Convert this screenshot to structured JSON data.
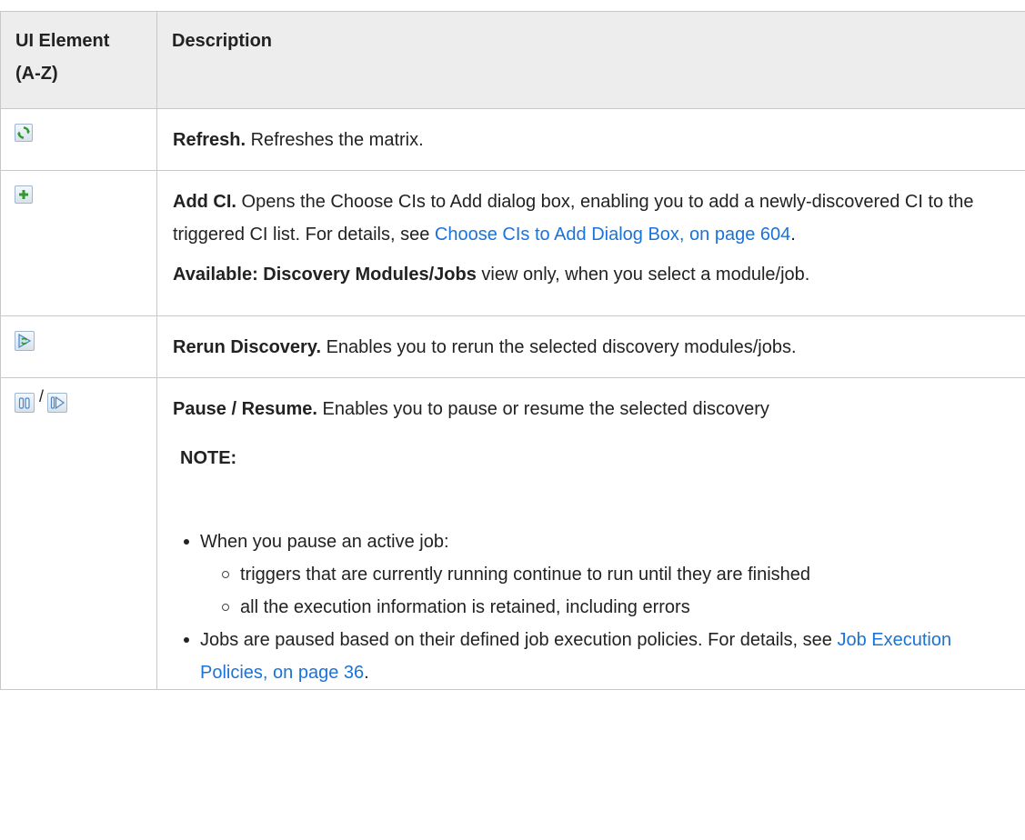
{
  "header": {
    "col1_line1": "UI Element",
    "col1_line2": "(A-Z)",
    "col2": "Description"
  },
  "colors": {
    "link": "#1a73d8",
    "header_bg": "#ededed",
    "border": "#c8c8c8"
  },
  "rows": {
    "refresh": {
      "icon": "refresh-icon",
      "title": "Refresh.",
      "text": " Refreshes the matrix."
    },
    "add_ci": {
      "icon": "add-icon",
      "title": "Add CI.",
      "text": " Opens the Choose CIs to Add dialog box, enabling you to add a newly-discovered CI to the triggered CI list. For details, see ",
      "link": "Choose CIs to Add Dialog Box, on page 604",
      "after_link": ".",
      "avail_title": "Available: Discovery Modules/Jobs",
      "avail_text": " view only, when you select a module/job."
    },
    "rerun": {
      "icon": "rerun-discovery-icon",
      "title": "Rerun Discovery.",
      "text": " Enables you to rerun the selected discovery modules/jobs."
    },
    "pause_resume": {
      "icon_pause": "pause-icon",
      "icon_resume": "resume-icon",
      "separator": "/",
      "title": "Pause / Resume.",
      "text": " Enables you to pause or resume the selected discovery",
      "note_label": "NOTE:",
      "bullet1": "When you pause an active job:",
      "sub1": "triggers that are currently running continue to run until they are finished",
      "sub2": "all the execution information is retained, including errors",
      "bullet2_text": "Jobs are paused based on their defined job execution policies. For details, see ",
      "bullet2_link": "Job Execution Policies, on page 36",
      "bullet2_after": "."
    }
  }
}
